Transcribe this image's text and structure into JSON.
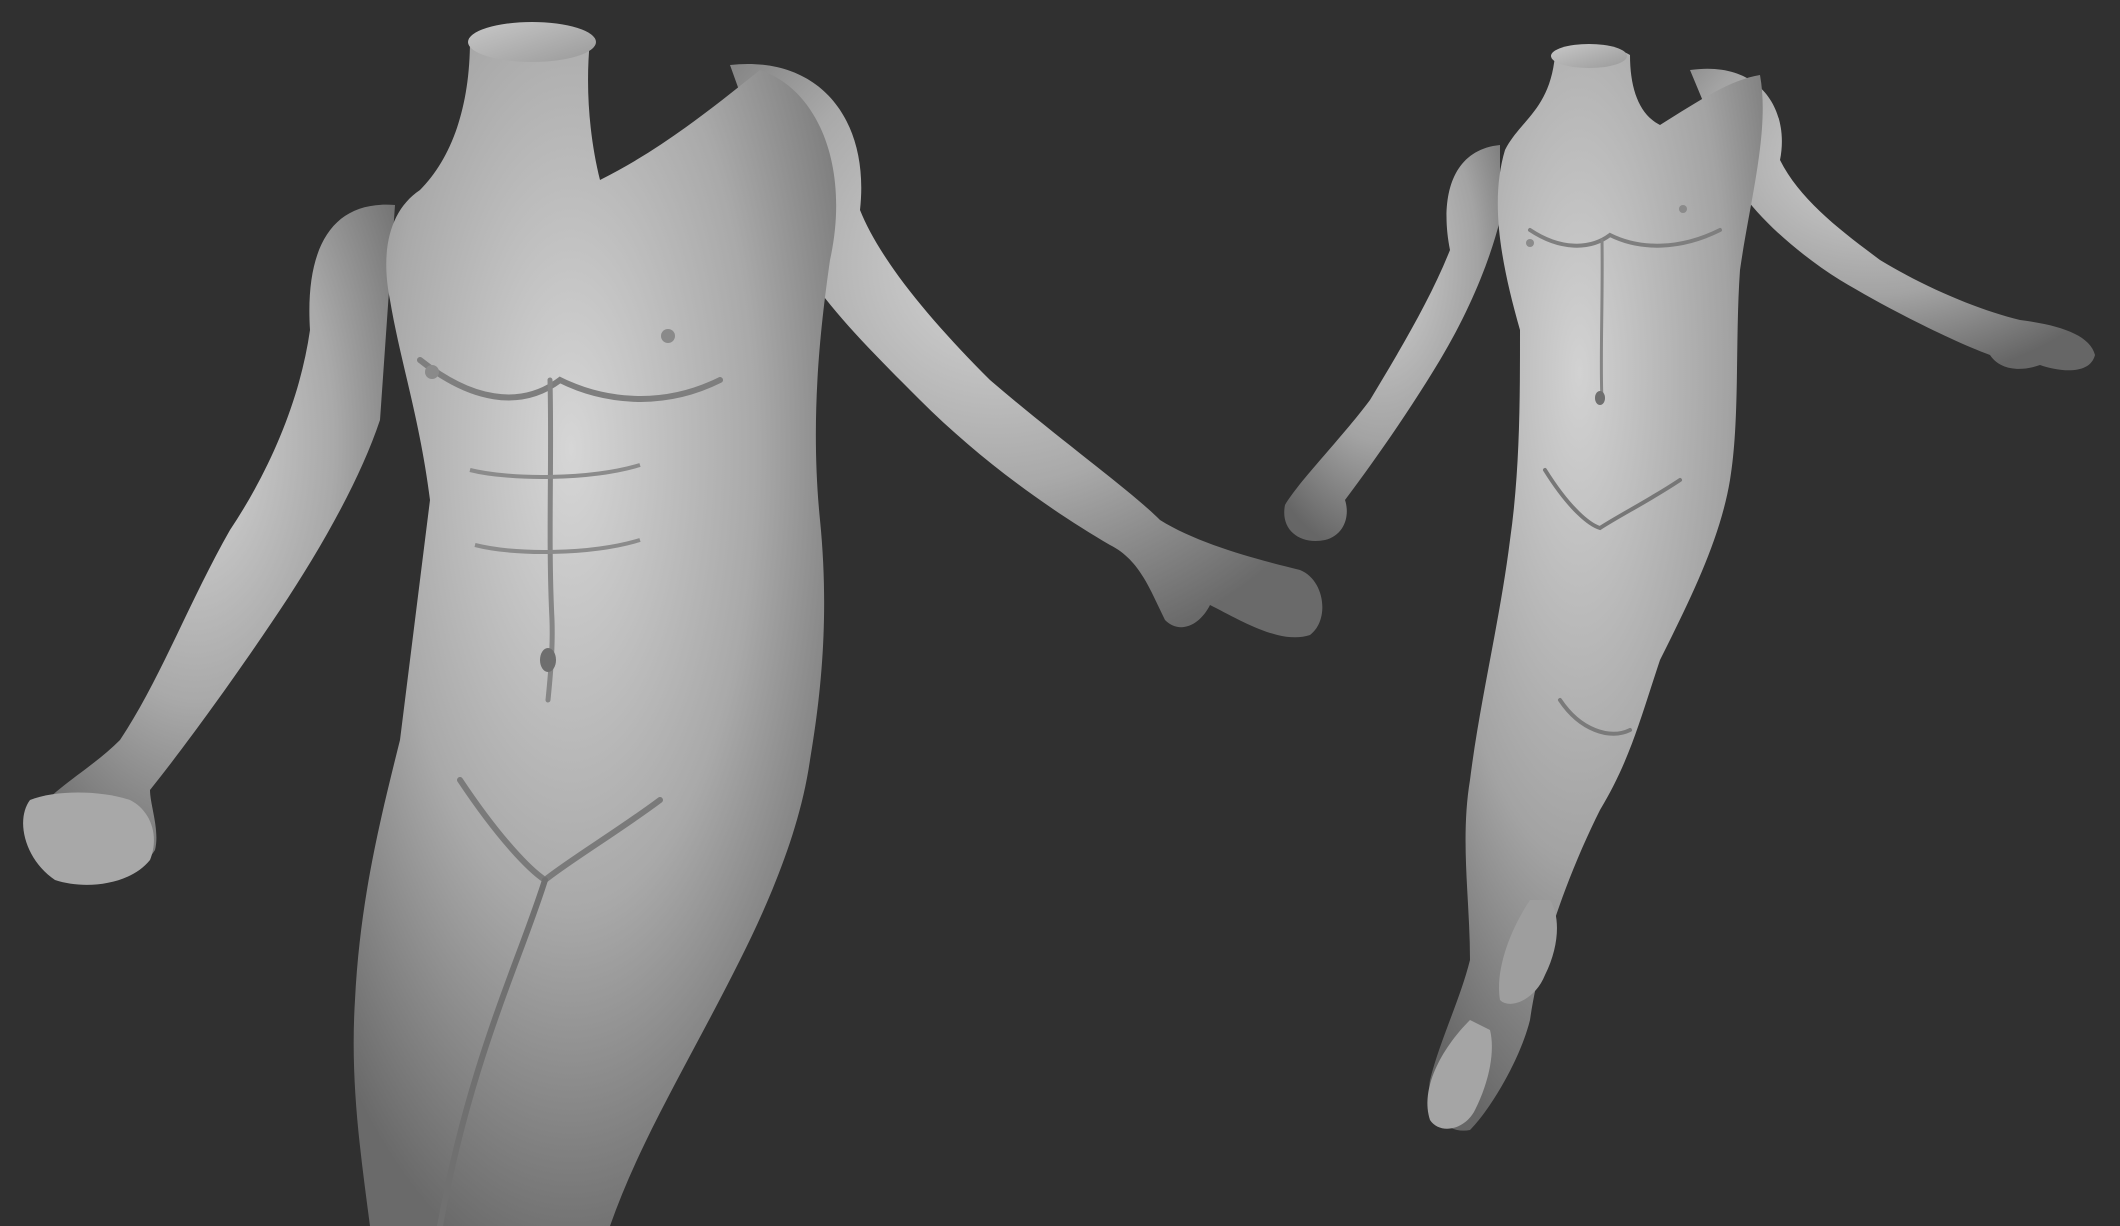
{
  "scene": {
    "background_color": "#303030",
    "material_color": "#b9b9b9",
    "subjects": [
      {
        "name": "male-anatomy-sculpt-close-up",
        "view": "torso-close-up"
      },
      {
        "name": "male-anatomy-sculpt-full-body",
        "view": "full-body"
      }
    ]
  }
}
